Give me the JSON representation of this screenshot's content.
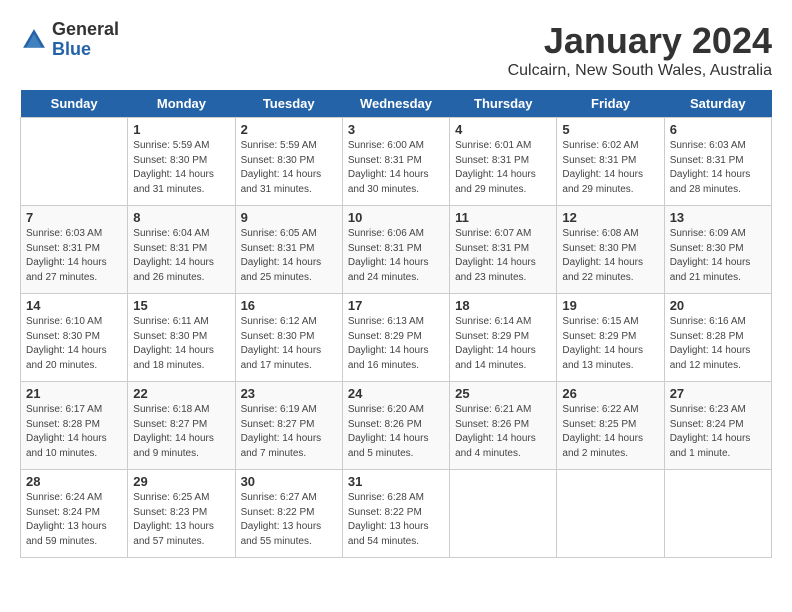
{
  "header": {
    "logo": {
      "general": "General",
      "blue": "Blue"
    },
    "month_title": "January 2024",
    "subtitle": "Culcairn, New South Wales, Australia"
  },
  "days_of_week": [
    "Sunday",
    "Monday",
    "Tuesday",
    "Wednesday",
    "Thursday",
    "Friday",
    "Saturday"
  ],
  "weeks": [
    [
      {
        "day": "",
        "empty": true
      },
      {
        "day": "1",
        "sunrise": "Sunrise: 5:59 AM",
        "sunset": "Sunset: 8:30 PM",
        "daylight": "Daylight: 14 hours and 31 minutes."
      },
      {
        "day": "2",
        "sunrise": "Sunrise: 5:59 AM",
        "sunset": "Sunset: 8:30 PM",
        "daylight": "Daylight: 14 hours and 31 minutes."
      },
      {
        "day": "3",
        "sunrise": "Sunrise: 6:00 AM",
        "sunset": "Sunset: 8:31 PM",
        "daylight": "Daylight: 14 hours and 30 minutes."
      },
      {
        "day": "4",
        "sunrise": "Sunrise: 6:01 AM",
        "sunset": "Sunset: 8:31 PM",
        "daylight": "Daylight: 14 hours and 29 minutes."
      },
      {
        "day": "5",
        "sunrise": "Sunrise: 6:02 AM",
        "sunset": "Sunset: 8:31 PM",
        "daylight": "Daylight: 14 hours and 29 minutes."
      },
      {
        "day": "6",
        "sunrise": "Sunrise: 6:03 AM",
        "sunset": "Sunset: 8:31 PM",
        "daylight": "Daylight: 14 hours and 28 minutes."
      }
    ],
    [
      {
        "day": "7",
        "sunrise": "Sunrise: 6:03 AM",
        "sunset": "Sunset: 8:31 PM",
        "daylight": "Daylight: 14 hours and 27 minutes."
      },
      {
        "day": "8",
        "sunrise": "Sunrise: 6:04 AM",
        "sunset": "Sunset: 8:31 PM",
        "daylight": "Daylight: 14 hours and 26 minutes."
      },
      {
        "day": "9",
        "sunrise": "Sunrise: 6:05 AM",
        "sunset": "Sunset: 8:31 PM",
        "daylight": "Daylight: 14 hours and 25 minutes."
      },
      {
        "day": "10",
        "sunrise": "Sunrise: 6:06 AM",
        "sunset": "Sunset: 8:31 PM",
        "daylight": "Daylight: 14 hours and 24 minutes."
      },
      {
        "day": "11",
        "sunrise": "Sunrise: 6:07 AM",
        "sunset": "Sunset: 8:31 PM",
        "daylight": "Daylight: 14 hours and 23 minutes."
      },
      {
        "day": "12",
        "sunrise": "Sunrise: 6:08 AM",
        "sunset": "Sunset: 8:30 PM",
        "daylight": "Daylight: 14 hours and 22 minutes."
      },
      {
        "day": "13",
        "sunrise": "Sunrise: 6:09 AM",
        "sunset": "Sunset: 8:30 PM",
        "daylight": "Daylight: 14 hours and 21 minutes."
      }
    ],
    [
      {
        "day": "14",
        "sunrise": "Sunrise: 6:10 AM",
        "sunset": "Sunset: 8:30 PM",
        "daylight": "Daylight: 14 hours and 20 minutes."
      },
      {
        "day": "15",
        "sunrise": "Sunrise: 6:11 AM",
        "sunset": "Sunset: 8:30 PM",
        "daylight": "Daylight: 14 hours and 18 minutes."
      },
      {
        "day": "16",
        "sunrise": "Sunrise: 6:12 AM",
        "sunset": "Sunset: 8:30 PM",
        "daylight": "Daylight: 14 hours and 17 minutes."
      },
      {
        "day": "17",
        "sunrise": "Sunrise: 6:13 AM",
        "sunset": "Sunset: 8:29 PM",
        "daylight": "Daylight: 14 hours and 16 minutes."
      },
      {
        "day": "18",
        "sunrise": "Sunrise: 6:14 AM",
        "sunset": "Sunset: 8:29 PM",
        "daylight": "Daylight: 14 hours and 14 minutes."
      },
      {
        "day": "19",
        "sunrise": "Sunrise: 6:15 AM",
        "sunset": "Sunset: 8:29 PM",
        "daylight": "Daylight: 14 hours and 13 minutes."
      },
      {
        "day": "20",
        "sunrise": "Sunrise: 6:16 AM",
        "sunset": "Sunset: 8:28 PM",
        "daylight": "Daylight: 14 hours and 12 minutes."
      }
    ],
    [
      {
        "day": "21",
        "sunrise": "Sunrise: 6:17 AM",
        "sunset": "Sunset: 8:28 PM",
        "daylight": "Daylight: 14 hours and 10 minutes."
      },
      {
        "day": "22",
        "sunrise": "Sunrise: 6:18 AM",
        "sunset": "Sunset: 8:27 PM",
        "daylight": "Daylight: 14 hours and 9 minutes."
      },
      {
        "day": "23",
        "sunrise": "Sunrise: 6:19 AM",
        "sunset": "Sunset: 8:27 PM",
        "daylight": "Daylight: 14 hours and 7 minutes."
      },
      {
        "day": "24",
        "sunrise": "Sunrise: 6:20 AM",
        "sunset": "Sunset: 8:26 PM",
        "daylight": "Daylight: 14 hours and 5 minutes."
      },
      {
        "day": "25",
        "sunrise": "Sunrise: 6:21 AM",
        "sunset": "Sunset: 8:26 PM",
        "daylight": "Daylight: 14 hours and 4 minutes."
      },
      {
        "day": "26",
        "sunrise": "Sunrise: 6:22 AM",
        "sunset": "Sunset: 8:25 PM",
        "daylight": "Daylight: 14 hours and 2 minutes."
      },
      {
        "day": "27",
        "sunrise": "Sunrise: 6:23 AM",
        "sunset": "Sunset: 8:24 PM",
        "daylight": "Daylight: 14 hours and 1 minute."
      }
    ],
    [
      {
        "day": "28",
        "sunrise": "Sunrise: 6:24 AM",
        "sunset": "Sunset: 8:24 PM",
        "daylight": "Daylight: 13 hours and 59 minutes."
      },
      {
        "day": "29",
        "sunrise": "Sunrise: 6:25 AM",
        "sunset": "Sunset: 8:23 PM",
        "daylight": "Daylight: 13 hours and 57 minutes."
      },
      {
        "day": "30",
        "sunrise": "Sunrise: 6:27 AM",
        "sunset": "Sunset: 8:22 PM",
        "daylight": "Daylight: 13 hours and 55 minutes."
      },
      {
        "day": "31",
        "sunrise": "Sunrise: 6:28 AM",
        "sunset": "Sunset: 8:22 PM",
        "daylight": "Daylight: 13 hours and 54 minutes."
      },
      {
        "day": "",
        "empty": true
      },
      {
        "day": "",
        "empty": true
      },
      {
        "day": "",
        "empty": true
      }
    ]
  ]
}
